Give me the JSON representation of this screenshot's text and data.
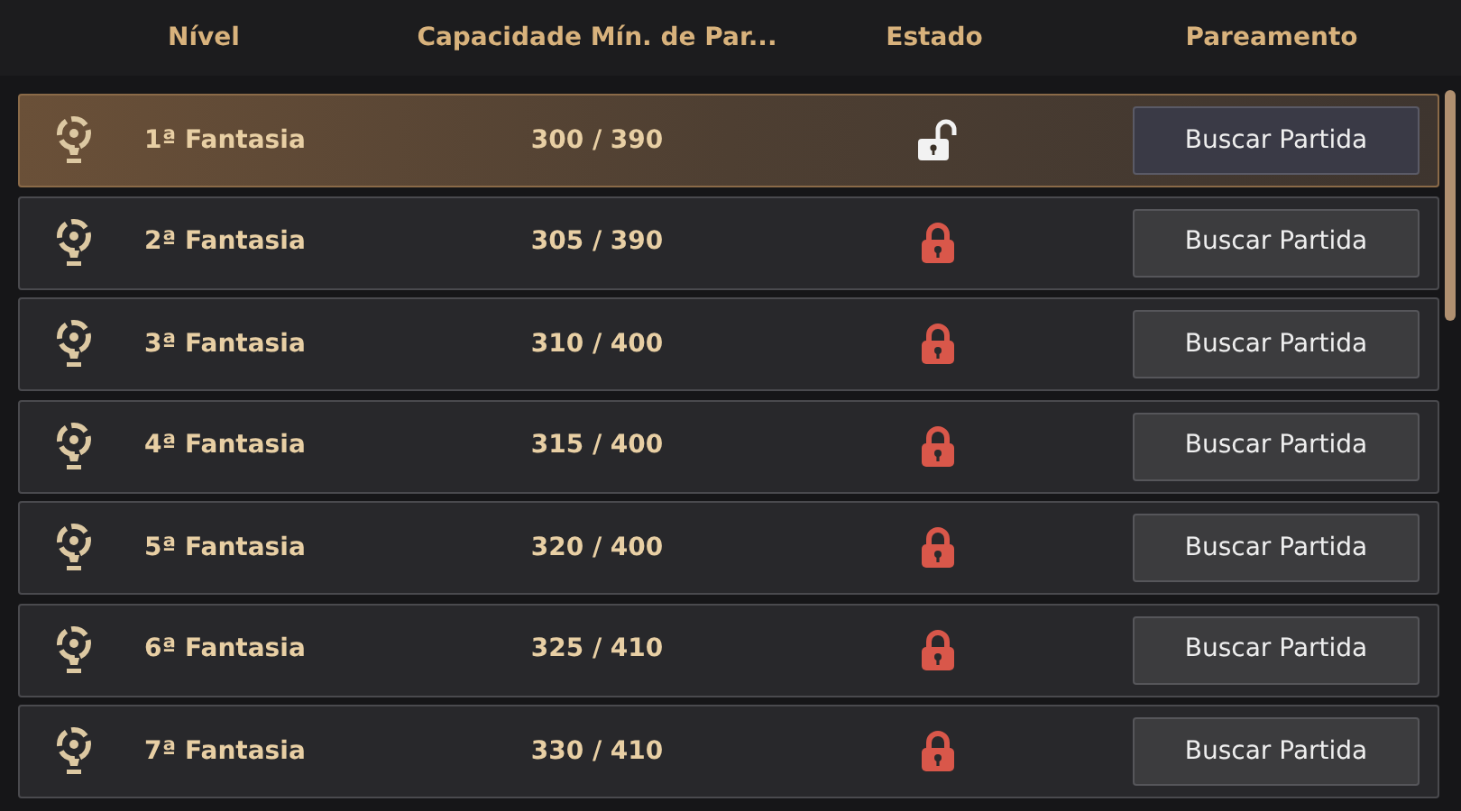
{
  "columns": [
    "Nível",
    "Capacidade Mín. de Par...",
    "Estado",
    "Pareamento"
  ],
  "rows": [
    {
      "level": "1ª Fantasia",
      "capacity": "300 / 390",
      "locked": false,
      "selected": true,
      "button": "Buscar Partida"
    },
    {
      "level": "2ª Fantasia",
      "capacity": "305 / 390",
      "locked": true,
      "selected": false,
      "button": "Buscar Partida"
    },
    {
      "level": "3ª Fantasia",
      "capacity": "310 / 400",
      "locked": true,
      "selected": false,
      "button": "Buscar Partida"
    },
    {
      "level": "4ª Fantasia",
      "capacity": "315 / 400",
      "locked": true,
      "selected": false,
      "button": "Buscar Partida"
    },
    {
      "level": "5ª Fantasia",
      "capacity": "320 / 400",
      "locked": true,
      "selected": false,
      "button": "Buscar Partida"
    },
    {
      "level": "6ª Fantasia",
      "capacity": "325 / 410",
      "locked": true,
      "selected": false,
      "button": "Buscar Partida"
    },
    {
      "level": "7ª Fantasia",
      "capacity": "330 / 410",
      "locked": true,
      "selected": false,
      "button": "Buscar Partida"
    }
  ]
}
